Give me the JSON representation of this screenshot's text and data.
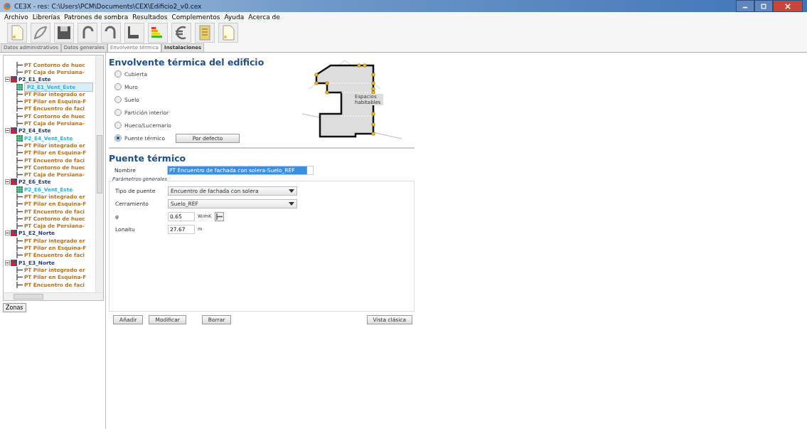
{
  "window": {
    "title": "CE3X - res: C:\\Users\\PCM\\Documents\\CEX\\Edificio2_v0.cex"
  },
  "menu": [
    "Archivo",
    "Librerías",
    "Patrones de sombra",
    "Resultados",
    "Complementos",
    "Ayuda",
    "Acerca de"
  ],
  "toolbar": [
    {
      "kind": "new"
    },
    {
      "kind": "open"
    },
    {
      "kind": "save"
    },
    {
      "kind": "undo"
    },
    {
      "kind": "redo"
    },
    {
      "kind": "arrow"
    },
    {
      "kind": "rating"
    },
    {
      "kind": "euro"
    },
    {
      "kind": "report"
    },
    {
      "kind": "doc"
    }
  ],
  "tabs": [
    {
      "label": "Datos administrativos",
      "selected": false
    },
    {
      "label": "Datos generales",
      "selected": false
    },
    {
      "label": "Envolvente térmica",
      "selected": true
    },
    {
      "label": "Instalaciones",
      "selected": false
    }
  ],
  "tree": [
    {
      "kind": "bridge",
      "label": "PT Contorno de huec"
    },
    {
      "kind": "bridge",
      "label": "PT Caja de Persiana-"
    },
    {
      "kind": "zone",
      "label": "P2_E1_Este",
      "expanded": true,
      "children": [
        {
          "kind": "window",
          "label": "P2_E1_Vent_Este",
          "selected": true
        },
        {
          "kind": "bridge",
          "label": "PT Pilar integrado er"
        },
        {
          "kind": "bridge",
          "label": "PT Pilar en Esquina-F"
        },
        {
          "kind": "bridge",
          "label": "PT Encuentro de faci"
        },
        {
          "kind": "bridge",
          "label": "PT Contorno de huec"
        },
        {
          "kind": "bridge",
          "label": "PT Caja de Persiana-"
        }
      ]
    },
    {
      "kind": "zone",
      "label": "P2_E4_Este",
      "expanded": true,
      "children": [
        {
          "kind": "window",
          "label": "P2_E4_Vent_Este",
          "selected": false
        },
        {
          "kind": "bridge",
          "label": "PT Pilar integrado er"
        },
        {
          "kind": "bridge",
          "label": "PT Pilar en Esquina-F"
        },
        {
          "kind": "bridge",
          "label": "PT Encuentro de faci"
        },
        {
          "kind": "bridge",
          "label": "PT Contorno de huec"
        },
        {
          "kind": "bridge",
          "label": "PT Caja de Persiana-"
        }
      ]
    },
    {
      "kind": "zone",
      "label": "P2_E6_Este",
      "expanded": true,
      "children": [
        {
          "kind": "window",
          "label": "P2_E6_Vent_Este",
          "selected": false
        },
        {
          "kind": "bridge",
          "label": "PT Pilar integrado er"
        },
        {
          "kind": "bridge",
          "label": "PT Pilar en Esquina-F"
        },
        {
          "kind": "bridge",
          "label": "PT Encuentro de faci"
        },
        {
          "kind": "bridge",
          "label": "PT Contorno de huec"
        },
        {
          "kind": "bridge",
          "label": "PT Caja de Persiana-"
        }
      ]
    },
    {
      "kind": "zone",
      "label": "P1_E2_Norte",
      "expanded": true,
      "children": [
        {
          "kind": "bridge",
          "label": "PT Pilar integrado er"
        },
        {
          "kind": "bridge",
          "label": "PT Pilar en Esquina-F"
        },
        {
          "kind": "bridge",
          "label": "PT Encuentro de faci"
        }
      ]
    },
    {
      "kind": "zone",
      "label": "P1_E3_Norte",
      "expanded": true,
      "children": [
        {
          "kind": "bridge",
          "label": "PT Pilar integrado er"
        },
        {
          "kind": "bridge",
          "label": "PT Pilar en Esquina-F"
        },
        {
          "kind": "bridge",
          "label": "PT Encuentro de faci"
        }
      ]
    }
  ],
  "zones_button": "Zonas",
  "envelope": {
    "title": "Envolvente térmica del edificio",
    "options": [
      {
        "label": "Cubierta",
        "selected": false
      },
      {
        "label": "Muro",
        "selected": false
      },
      {
        "label": "Suelo",
        "selected": false
      },
      {
        "label": "Partición interior",
        "selected": false
      },
      {
        "label": "Hueco/Lucernario",
        "selected": false
      },
      {
        "label": "Puente térmico",
        "selected": true
      }
    ],
    "default_button": "Por defecto",
    "diagram_label": "Espacios habitables"
  },
  "bridge": {
    "title": "Puente térmico",
    "name_label": "Nombre",
    "name_value": "PT Encuentro de fachada con solera-Suelo_REF",
    "group": "Parámetros generales",
    "fields": [
      {
        "kind": "select",
        "label": "Tipo de puente",
        "value": "Encuentro de fachada con solera"
      },
      {
        "kind": "select",
        "label": "Cerramiento",
        "value": "Suelo_REF"
      },
      {
        "kind": "number",
        "label": "φ",
        "value": "0.65",
        "unit": "W/mK",
        "helper": true
      },
      {
        "kind": "number",
        "label": "Lonaitu",
        "value": "27.67",
        "unit": "m"
      }
    ]
  },
  "buttons": [
    "Añadir",
    "Modificar",
    "Borrar"
  ],
  "classic_button": "Vista clásica"
}
